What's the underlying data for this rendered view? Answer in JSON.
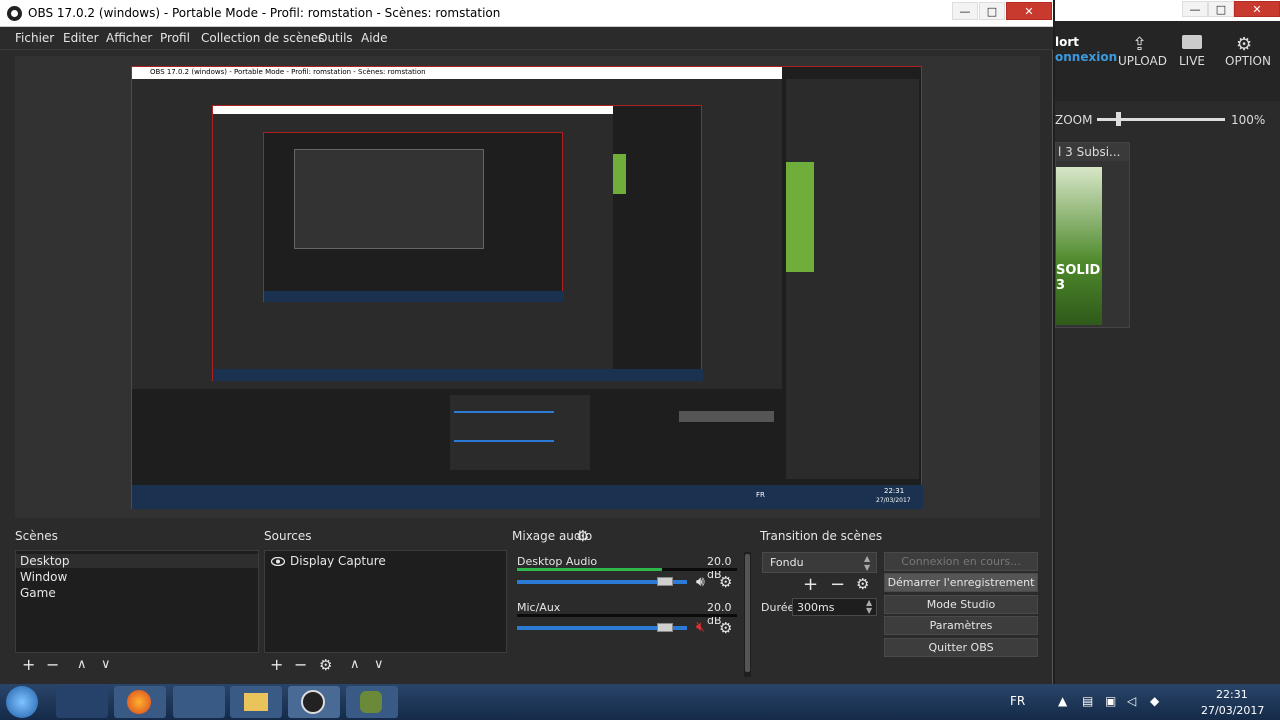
{
  "window": {
    "title": "OBS 17.0.2 (windows) - Portable Mode - Profil: romstation - Scènes: romstation",
    "controls": {
      "minimize": "—",
      "maximize": "□",
      "close": "✕"
    }
  },
  "menu": [
    "Fichier",
    "Editer",
    "Afficher",
    "Profil",
    "Collection de scènes",
    "Outils",
    "Aide"
  ],
  "preview": {
    "nested_title": "OBS 17.0.2 (windows) - Portable Mode - Profil: romstation - Scènes: romstation",
    "nested_clock": "22:31",
    "nested_date": "27/03/2017",
    "nested_lang": "FR"
  },
  "scenes": {
    "title": "Scènes",
    "items": [
      "Desktop",
      "Window",
      "Game"
    ],
    "toolbar": {
      "add": "+",
      "remove": "−",
      "up": "∧",
      "down": "∨"
    }
  },
  "sources": {
    "title": "Sources",
    "items": [
      "Display Capture"
    ],
    "toolbar": {
      "add": "+",
      "remove": "−",
      "settings": "⚙",
      "up": "∧",
      "down": "∨"
    }
  },
  "mixer": {
    "title": "Mixage audio",
    "channels": [
      {
        "name": "Desktop Audio",
        "db": "20.0 dB",
        "level": 0.87,
        "muted": false
      },
      {
        "name": "Mic/Aux",
        "db": "20.0 dB",
        "level": 0.87,
        "muted": true
      }
    ]
  },
  "transitions": {
    "title": "Transition de scènes",
    "selected": "Fondu",
    "duration_label": "Durée",
    "duration_value": "300ms"
  },
  "controls": {
    "connecting": "Connexion en cours...",
    "record": "Démarrer l'enregistrement",
    "studio": "Mode Studio",
    "settings": "Paramètres",
    "quit": "Quitter OBS"
  },
  "side": {
    "partial_title": "lort",
    "connexion": "onnexion",
    "upload": "UPLOAD",
    "live": "LIVE",
    "option": "OPTION",
    "zoom_label": "ZOOM",
    "zoom_value": "100%",
    "zoom_level": 0.15,
    "game_tab": "l 3 Subsi..."
  },
  "taskbar": {
    "lang": "FR",
    "time": "22:31",
    "date": "27/03/2017"
  },
  "colors": {
    "accent": "#2a7ad6",
    "panel": "#2b2b2b",
    "list_bg": "#1e1e1e",
    "mute_red": "#e03030",
    "meter_green": "#2fb84a"
  }
}
